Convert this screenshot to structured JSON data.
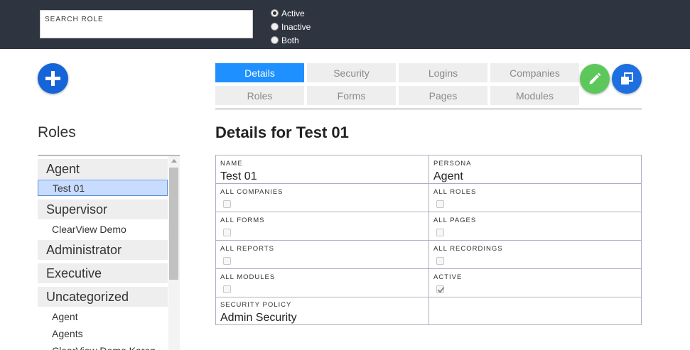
{
  "search": {
    "label": "SEARCH ROLE",
    "value": ""
  },
  "status_filter": {
    "options": [
      {
        "label": "Active",
        "checked": true
      },
      {
        "label": "Inactive",
        "checked": false
      },
      {
        "label": "Both",
        "checked": false
      }
    ]
  },
  "tabs": [
    {
      "label": "Details",
      "active": true
    },
    {
      "label": "Security",
      "active": false
    },
    {
      "label": "Logins",
      "active": false
    },
    {
      "label": "Companies",
      "active": false
    },
    {
      "label": "Roles",
      "active": false
    },
    {
      "label": "Forms",
      "active": false
    },
    {
      "label": "Pages",
      "active": false
    },
    {
      "label": "Modules",
      "active": false
    }
  ],
  "sidebar": {
    "title": "Roles",
    "groups": [
      {
        "label": "Agent"
      },
      {
        "label": "Supervisor"
      },
      {
        "label": "Administrator"
      },
      {
        "label": "Executive"
      },
      {
        "label": "Uncategorized"
      }
    ],
    "items": [
      {
        "label": "Test 01",
        "selected": true
      },
      {
        "label": "ClearView Demo",
        "selected": false
      },
      {
        "label": "Agent",
        "selected": false
      },
      {
        "label": "Agents",
        "selected": false
      },
      {
        "label": "ClearView Demo Karen",
        "selected": false
      }
    ]
  },
  "details": {
    "title": "Details for Test 01",
    "name_label": "NAME",
    "name_value": "Test 01",
    "persona_label": "PERSONA",
    "persona_value": "Agent",
    "all_companies_label": "ALL COMPANIES",
    "all_roles_label": "ALL ROLES",
    "all_forms_label": "ALL FORMS",
    "all_pages_label": "ALL PAGES",
    "all_reports_label": "ALL REPORTS",
    "all_recordings_label": "ALL RECORDINGS",
    "all_modules_label": "ALL MODULES",
    "active_label": "ACTIVE",
    "security_policy_label": "SECURITY POLICY",
    "security_policy_value": "Admin Security",
    "flags": {
      "all_companies": false,
      "all_roles": false,
      "all_forms": false,
      "all_pages": false,
      "all_reports": false,
      "all_recordings": false,
      "all_modules": false,
      "active": true
    }
  },
  "colors": {
    "topbar": "#2e3440",
    "active_tab": "#1e90ff",
    "add_button": "#1565d8",
    "edit_button": "#5cc85c",
    "copy_button": "#1e6fe0"
  },
  "icons": {
    "add": "plus-icon",
    "edit": "pencil-icon",
    "copy": "copy-icon"
  }
}
